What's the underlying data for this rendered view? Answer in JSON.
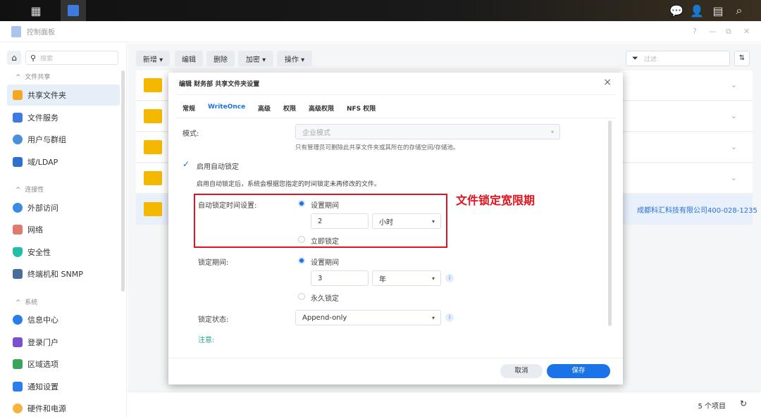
{
  "window": {
    "title": "控制面板",
    "controls": [
      "?",
      "—",
      "⧉",
      "✕"
    ]
  },
  "sidebar": {
    "search_placeholder": "搜索",
    "sections": [
      {
        "header": "文件共享",
        "items": [
          "共享文件夹",
          "文件服务",
          "用户与群组",
          "域/LDAP"
        ]
      },
      {
        "header": "连接性",
        "items": [
          "外部访问",
          "网络",
          "安全性",
          "终端机和 SNMP"
        ]
      },
      {
        "header": "系统",
        "items": [
          "信息中心",
          "登录门户",
          "区域选项",
          "通知设置",
          "硬件和电源"
        ]
      }
    ],
    "active": "共享文件夹"
  },
  "toolbar": {
    "new": "新增 ▾",
    "edit": "编辑",
    "delete": "删除",
    "encrypt": "加密 ▾",
    "action": "操作 ▾",
    "filter_placeholder": "过滤"
  },
  "status": {
    "count": "5 个项目"
  },
  "watermark": "成都科汇科技有限公司400-028-1235",
  "dialog": {
    "title": "编辑 财务部 共享文件夹设置",
    "tabs": [
      "常规",
      "WriteOnce",
      "高级",
      "权限",
      "高级权限",
      "NFS 权限"
    ],
    "active_tab": "WriteOnce",
    "mode_label": "模式:",
    "mode_value": "企业模式",
    "mode_note": "只有管理员可删除此共享文件夹或其所在的存储空间/存储池。",
    "auto_lock_label": "启用自动锁定",
    "auto_lock_desc": "启用自动锁定后，系统会根据您指定的时间锁定未再修改的文件。",
    "auto_lock_time_label": "自动锁定时间设置:",
    "opt_set_period": "设置期间",
    "auto_lock_value": "2",
    "auto_lock_unit": "小时",
    "opt_immediate": "立即锁定",
    "lock_period_label": "锁定期间:",
    "lock_period_value": "3",
    "lock_period_unit": "年",
    "opt_permanent": "永久锁定",
    "lock_state_label": "锁定状态:",
    "lock_state_value": "Append-only",
    "note_label": "注意:",
    "cancel": "取消",
    "save": "保存"
  },
  "annotation": "文件锁定宽限期",
  "colors": {
    "accent": "#1a73e8",
    "annotation": "#e0141e"
  }
}
